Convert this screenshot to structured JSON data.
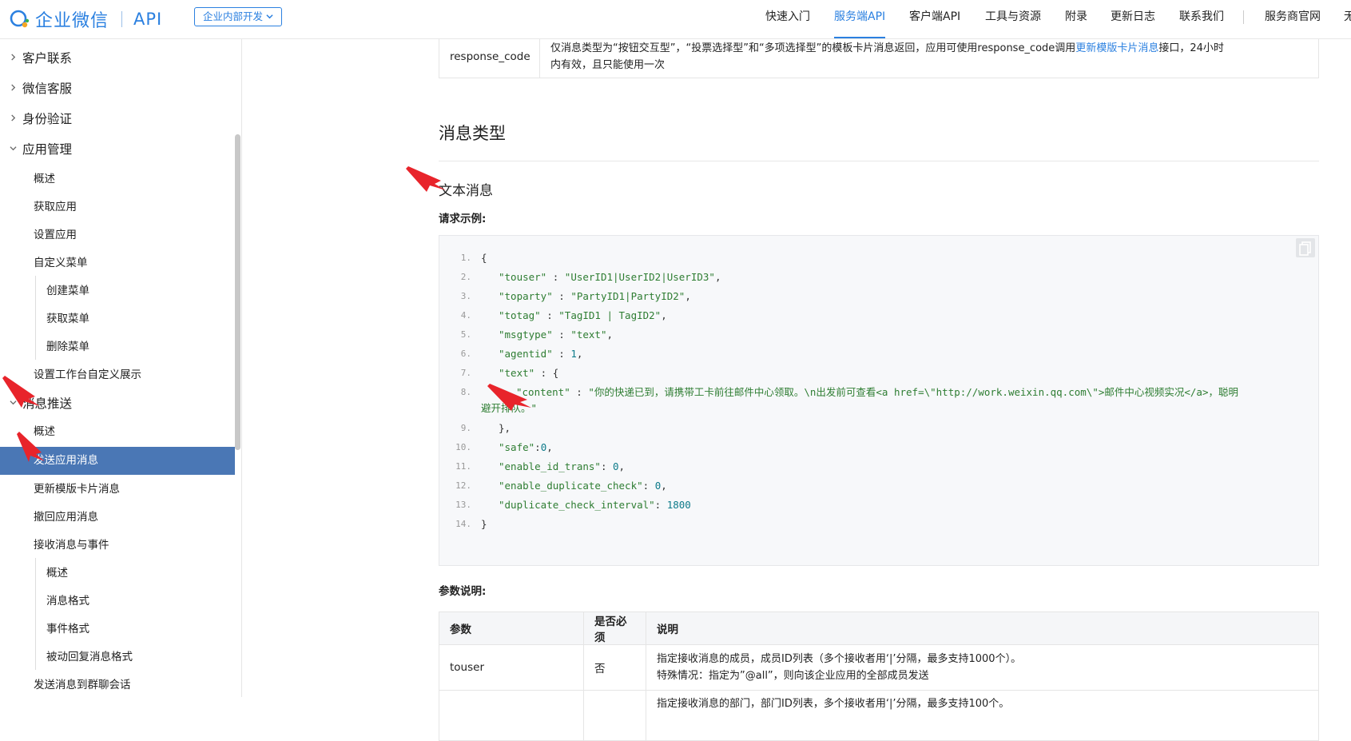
{
  "header": {
    "logo_text": "企业微信",
    "logo_api": "API",
    "dev_select": "企业内部开发",
    "nav": [
      {
        "label": "快速入门",
        "active": false
      },
      {
        "label": "服务端API",
        "active": true
      },
      {
        "label": "客户端API",
        "active": false
      },
      {
        "label": "工具与资源",
        "active": false
      },
      {
        "label": "附录",
        "active": false
      },
      {
        "label": "更新日志",
        "active": false
      },
      {
        "label": "联系我们",
        "active": false
      },
      {
        "label": "服务商官网",
        "active": false
      },
      {
        "label": "无",
        "active": false
      }
    ]
  },
  "sidebar": {
    "items": [
      {
        "label": "客户联系",
        "expanded": false
      },
      {
        "label": "微信客服",
        "expanded": false
      },
      {
        "label": "身份验证",
        "expanded": false
      },
      {
        "label": "应用管理",
        "expanded": true
      },
      {
        "label": "概述"
      },
      {
        "label": "获取应用"
      },
      {
        "label": "设置应用"
      },
      {
        "label": "自定义菜单"
      },
      {
        "label": "创建菜单"
      },
      {
        "label": "获取菜单"
      },
      {
        "label": "删除菜单"
      },
      {
        "label": "设置工作台自定义展示"
      },
      {
        "label": "消息推送",
        "expanded": true
      },
      {
        "label": "概述"
      },
      {
        "label": "发送应用消息",
        "active": true
      },
      {
        "label": "更新模版卡片消息"
      },
      {
        "label": "撤回应用消息"
      },
      {
        "label": "接收消息与事件"
      },
      {
        "label": "概述"
      },
      {
        "label": "消息格式"
      },
      {
        "label": "事件格式"
      },
      {
        "label": "被动回复消息格式"
      },
      {
        "label": "发送消息到群聊会话"
      }
    ]
  },
  "response_row": {
    "key": "response_code",
    "desc_before": "仅消息类型为“按钮交互型”，“投票选择型”和“多项选择型”的模板卡片消息返回，应用可使用response_code调用",
    "desc_link": "更新模版卡片消息",
    "desc_after": "接口，24小时",
    "desc_line2": "内有效，且只能使用一次"
  },
  "section_title": "消息类型",
  "sub_title": "文本消息",
  "request_label": "请求示例:",
  "code": {
    "lines": [
      {
        "n": "1.",
        "text": "{"
      },
      {
        "n": "2.",
        "key": "\"touser\"",
        "sep": " : ",
        "val": "\"UserID1|UserID2|UserID3\"",
        "tail": ","
      },
      {
        "n": "3.",
        "key": "\"toparty\"",
        "sep": " : ",
        "val": "\"PartyID1|PartyID2\"",
        "tail": ","
      },
      {
        "n": "4.",
        "key": "\"totag\"",
        "sep": " : ",
        "val": "\"TagID1 | TagID2\"",
        "tail": ","
      },
      {
        "n": "5.",
        "key": "\"msgtype\"",
        "sep": " : ",
        "val": "\"text\"",
        "tail": ","
      },
      {
        "n": "6.",
        "key": "\"agentid\"",
        "sep": " : ",
        "num": "1",
        "tail": ","
      },
      {
        "n": "7.",
        "key": "\"text\"",
        "sep": " : ",
        "tail": "{"
      },
      {
        "n": "8.",
        "key": "\"content\"",
        "sep": " : ",
        "val": "\"你的快递已到，请携带工卡前往邮件中心领取。\\n出发前可查看<a href=\\\"http://work.weixin.qq.com\\\">邮件中心视频实况</a>，聪明",
        "wrap": "避开排队。\""
      },
      {
        "n": "9.",
        "text": "},"
      },
      {
        "n": "10.",
        "key": "\"safe\"",
        "sep": ":",
        "num": "0",
        "tail": ","
      },
      {
        "n": "11.",
        "key": "\"enable_id_trans\"",
        "sep": ": ",
        "num": "0",
        "tail": ","
      },
      {
        "n": "12.",
        "key": "\"enable_duplicate_check\"",
        "sep": ": ",
        "num": "0",
        "tail": ","
      },
      {
        "n": "13.",
        "key": "\"duplicate_check_interval\"",
        "sep": ": ",
        "num": "1800",
        "tail": ""
      },
      {
        "n": "14.",
        "text": "}"
      }
    ]
  },
  "params_label": "参数说明:",
  "params_table": {
    "headers": [
      "参数",
      "是否必须",
      "说明"
    ],
    "rows": [
      {
        "param": "touser",
        "required": "否",
        "desc_line1": "指定接收消息的成员，成员ID列表（多个接收者用‘|’分隔，最多支持1000个）。",
        "desc_line2": "特殊情况：指定为”@all”，则向该企业应用的全部成员发送"
      },
      {
        "param": "",
        "required": "",
        "desc_line1": "指定接收消息的部门，部门ID列表，多个接收者用‘|’分隔，最多支持100个。",
        "desc_line2": ""
      }
    ]
  },
  "colors": {
    "brand": "#2b80e0",
    "active_bg": "#4a77b5",
    "annotation": "#e8242b"
  }
}
